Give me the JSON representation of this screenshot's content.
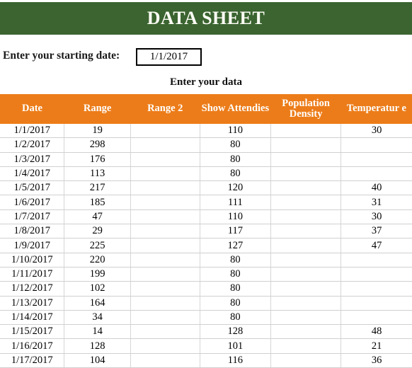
{
  "title": "DATA SHEET",
  "start_date": {
    "label": "Enter your starting date:",
    "value": "1/1/2017",
    "placeholder": "1/1/2017"
  },
  "data_caption": "Enter your data",
  "colors": {
    "banner_green": "#3b6430",
    "header_orange": "#ec7c19",
    "grid_line": "#d0d0d0",
    "title_text": "#fdfdf5"
  },
  "table": {
    "columns": [
      "Date",
      "Range",
      "Range 2",
      "Show Attendies",
      "Population Density",
      "Temperatur e"
    ],
    "rows": [
      [
        "1/1/2017",
        "19",
        "",
        "110",
        "",
        "30"
      ],
      [
        "1/2/2017",
        "298",
        "",
        "80",
        "",
        ""
      ],
      [
        "1/3/2017",
        "176",
        "",
        "80",
        "",
        ""
      ],
      [
        "1/4/2017",
        "113",
        "",
        "80",
        "",
        ""
      ],
      [
        "1/5/2017",
        "217",
        "",
        "120",
        "",
        "40"
      ],
      [
        "1/6/2017",
        "185",
        "",
        "111",
        "",
        "31"
      ],
      [
        "1/7/2017",
        "47",
        "",
        "110",
        "",
        "30"
      ],
      [
        "1/8/2017",
        "29",
        "",
        "117",
        "",
        "37"
      ],
      [
        "1/9/2017",
        "225",
        "",
        "127",
        "",
        "47"
      ],
      [
        "1/10/2017",
        "220",
        "",
        "80",
        "",
        ""
      ],
      [
        "1/11/2017",
        "199",
        "",
        "80",
        "",
        ""
      ],
      [
        "1/12/2017",
        "102",
        "",
        "80",
        "",
        ""
      ],
      [
        "1/13/2017",
        "164",
        "",
        "80",
        "",
        ""
      ],
      [
        "1/14/2017",
        "34",
        "",
        "80",
        "",
        ""
      ],
      [
        "1/15/2017",
        "14",
        "",
        "128",
        "",
        "48"
      ],
      [
        "1/16/2017",
        "128",
        "",
        "101",
        "",
        "21"
      ],
      [
        "1/17/2017",
        "104",
        "",
        "116",
        "",
        "36"
      ]
    ]
  },
  "chart_data": {
    "type": "table",
    "title": "DATA SHEET",
    "columns": [
      "Date",
      "Range",
      "Range 2",
      "Show Attendies",
      "Population Density",
      "Temperature"
    ],
    "series": [
      {
        "name": "Range",
        "values": [
          19,
          298,
          176,
          113,
          217,
          185,
          47,
          29,
          225,
          220,
          199,
          102,
          164,
          34,
          14,
          128,
          104
        ]
      },
      {
        "name": "Range 2",
        "values": [
          null,
          null,
          null,
          null,
          null,
          null,
          null,
          null,
          null,
          null,
          null,
          null,
          null,
          null,
          null,
          null,
          null
        ]
      },
      {
        "name": "Show Attendies",
        "values": [
          110,
          80,
          80,
          80,
          120,
          111,
          110,
          117,
          127,
          80,
          80,
          80,
          80,
          80,
          128,
          101,
          116
        ]
      },
      {
        "name": "Population Density",
        "values": [
          null,
          null,
          null,
          null,
          null,
          null,
          null,
          null,
          null,
          null,
          null,
          null,
          null,
          null,
          null,
          null,
          null
        ]
      },
      {
        "name": "Temperature",
        "values": [
          30,
          null,
          null,
          null,
          40,
          31,
          30,
          37,
          47,
          null,
          null,
          null,
          null,
          null,
          48,
          21,
          36
        ]
      }
    ],
    "categories": [
      "1/1/2017",
      "1/2/2017",
      "1/3/2017",
      "1/4/2017",
      "1/5/2017",
      "1/6/2017",
      "1/7/2017",
      "1/8/2017",
      "1/9/2017",
      "1/10/2017",
      "1/11/2017",
      "1/12/2017",
      "1/13/2017",
      "1/14/2017",
      "1/15/2017",
      "1/16/2017",
      "1/17/2017"
    ],
    "xlabel": "Date",
    "ylabel": ""
  }
}
